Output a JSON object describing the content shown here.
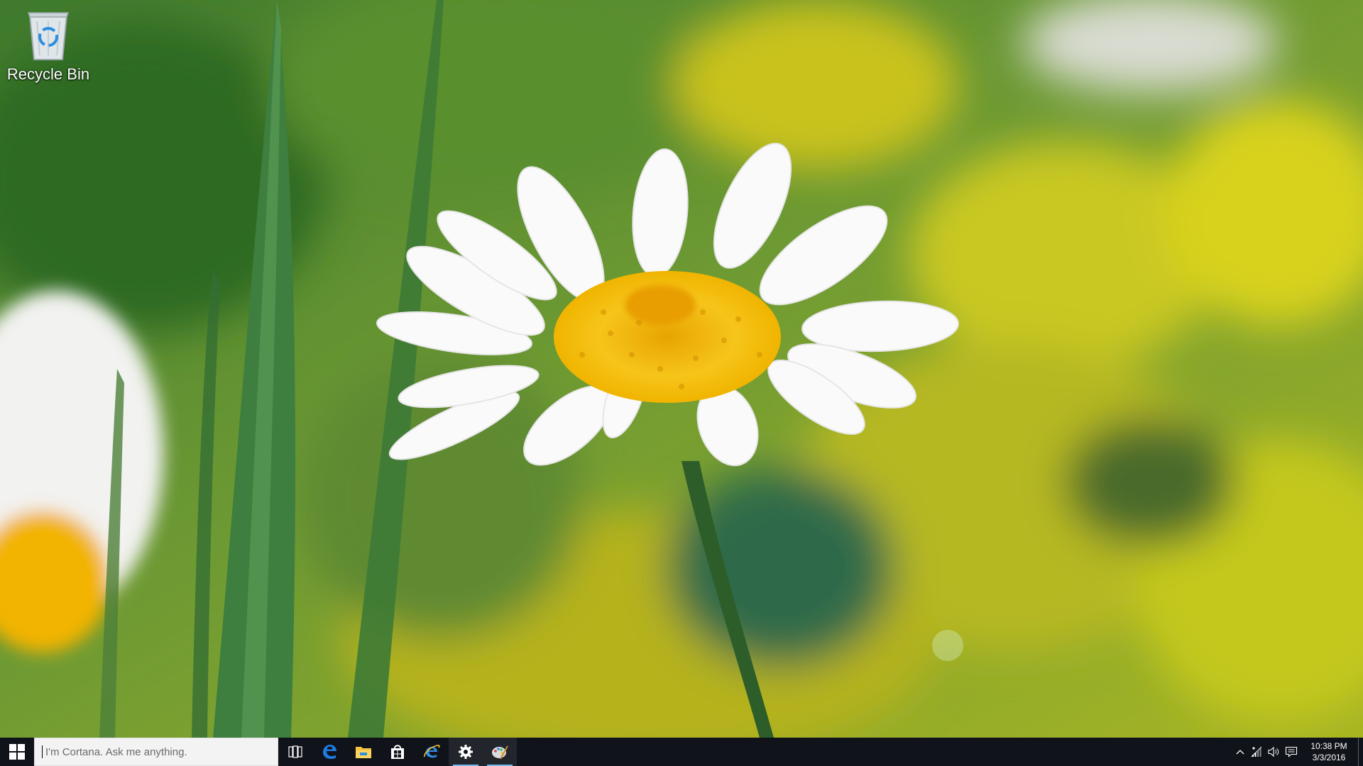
{
  "desktop": {
    "icons": [
      {
        "label": "Recycle Bin",
        "icon": "recycle-bin-icon"
      }
    ]
  },
  "taskbar": {
    "start": {
      "icon": "windows-logo-icon"
    },
    "search": {
      "placeholder": "I'm Cortana. Ask me anything.",
      "value": ""
    },
    "pinned": [
      {
        "icon": "task-view-icon",
        "active": false
      },
      {
        "icon": "edge-icon",
        "active": false
      },
      {
        "icon": "file-explorer-icon",
        "active": false
      },
      {
        "icon": "store-icon",
        "active": false
      },
      {
        "icon": "internet-explorer-icon",
        "active": false
      },
      {
        "icon": "settings-gear-icon",
        "active": true
      },
      {
        "icon": "paint-icon",
        "active": true
      }
    ],
    "tray": {
      "icons": [
        "chevron-up-icon",
        "network-icon",
        "volume-icon",
        "action-center-icon"
      ],
      "time": "10:38 PM",
      "date": "3/3/2016"
    },
    "accent_color": "#76b9ed",
    "background_color": "#10131a"
  }
}
